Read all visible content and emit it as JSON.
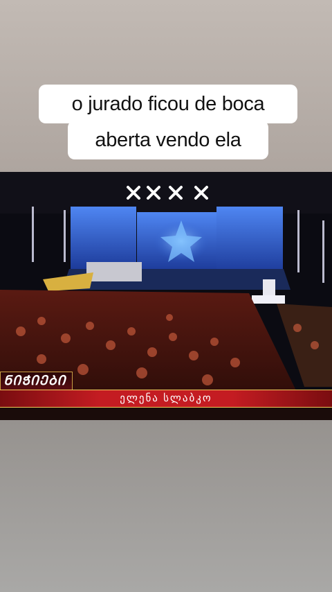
{
  "caption": {
    "line1": "o jurado ficou de boca",
    "line2": "aberta vendo ela"
  },
  "video": {
    "show_logo": "ᲜᲘᲭᲘᲔᲑᲘ",
    "contestant_name": "ელენა სლაბკო"
  },
  "colors": {
    "caption_bg": "#ffffff",
    "lower_third_red": "#c41c22",
    "lower_third_gold": "#f3c95a",
    "stage_blue": "#3a6ee0"
  }
}
